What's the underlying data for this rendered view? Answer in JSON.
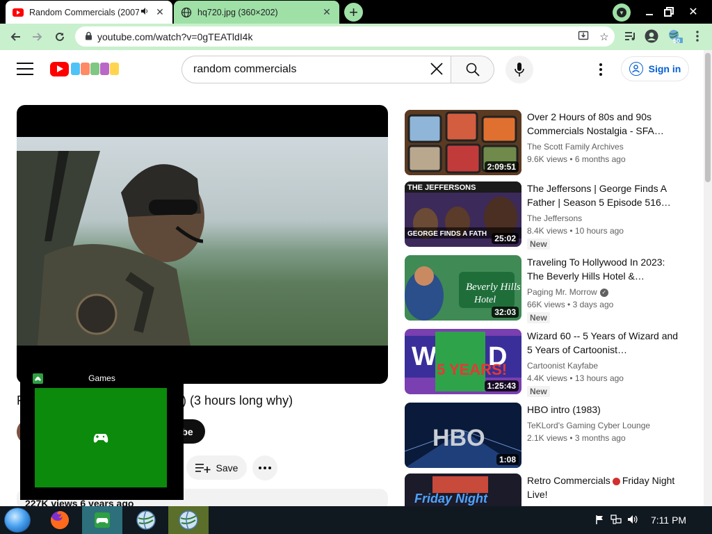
{
  "browser": {
    "tabs": [
      {
        "title": "Random Commercials (2007",
        "active": true,
        "audio": true
      },
      {
        "title": "hq720.jpg (360×202)",
        "active": false
      }
    ],
    "new_tab": "+",
    "url": "youtube.com/watch?v=0gTEATldI4k",
    "extension_badge": "50"
  },
  "youtube": {
    "search_query": "random commercials",
    "signin_label": "Sign in"
  },
  "video": {
    "title": "F                    ) (3 hours long why)",
    "title_visible_fragment": "F",
    "title_tail": ") (3 hours long why)",
    "subscribe_label": "be",
    "save_label": "Save",
    "views_line": "227K views  6 years ago"
  },
  "games_overlay": {
    "header": "Games"
  },
  "related": [
    {
      "title": "Over 2 Hours of 80s and 90s Commercials Nostalgia - SFA…",
      "channel": "The Scott Family Archives",
      "views": "9.6K views",
      "age": "6 months ago",
      "duration": "2:09:51",
      "is_new": false,
      "verified": false
    },
    {
      "title": "The Jeffersons | George Finds A Father | Season 5 Episode 516…",
      "channel": "The Jeffersons",
      "views": "8.4K views",
      "age": "10 hours ago",
      "duration": "25:02",
      "is_new": true,
      "verified": false
    },
    {
      "title": "Traveling To Hollywood In 2023: The Beverly Hills Hotel &…",
      "channel": "Paging Mr. Morrow",
      "views": "66K views",
      "age": "3 days ago",
      "duration": "32:03",
      "is_new": true,
      "verified": true
    },
    {
      "title": "Wizard 60 -- 5 Years of Wizard and 5 Years of Cartoonist…",
      "channel": "Cartoonist Kayfabe",
      "views": "4.4K views",
      "age": "13 hours ago",
      "duration": "1:25:43",
      "is_new": true,
      "verified": false
    },
    {
      "title": "HBO intro (1983)",
      "channel": "TeKLord's Gaming Cyber Lounge",
      "views": "2.1K views",
      "age": "3 months ago",
      "duration": "1:08",
      "is_new": false,
      "verified": false
    },
    {
      "title_a": "Retro Commercials",
      "title_b": "Friday Night Live!",
      "duration": ""
    }
  ],
  "new_label": "New",
  "taskbar": {
    "clock": "7:11 PM"
  },
  "colors": {
    "youtube_red": "#ff0000",
    "link_blue": "#065fd4",
    "chrome_green": "#9fe0a6",
    "xbox_green": "#0b8a0b"
  }
}
